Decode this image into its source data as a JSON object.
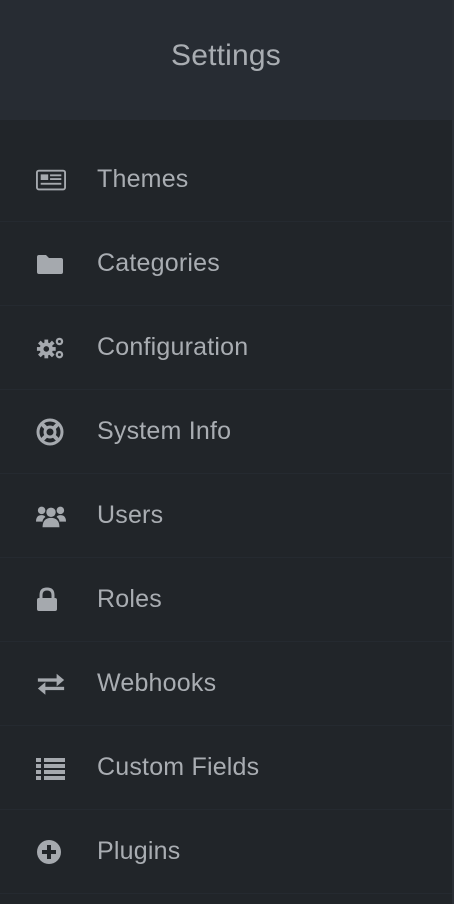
{
  "header": {
    "title": "Settings"
  },
  "menu": {
    "items": [
      {
        "label": "Themes",
        "icon": "newspaper-icon"
      },
      {
        "label": "Categories",
        "icon": "folder-icon"
      },
      {
        "label": "Configuration",
        "icon": "gears-icon"
      },
      {
        "label": "System Info",
        "icon": "life-ring-icon"
      },
      {
        "label": "Users",
        "icon": "users-icon"
      },
      {
        "label": "Roles",
        "icon": "lock-icon"
      },
      {
        "label": "Webhooks",
        "icon": "exchange-icon"
      },
      {
        "label": "Custom Fields",
        "icon": "list-icon"
      },
      {
        "label": "Plugins",
        "icon": "plus-circle-icon"
      }
    ]
  },
  "colors": {
    "background": "#212529",
    "header_background": "#272c33",
    "text": "#a9adb2",
    "icon": "#a5a9ae"
  }
}
